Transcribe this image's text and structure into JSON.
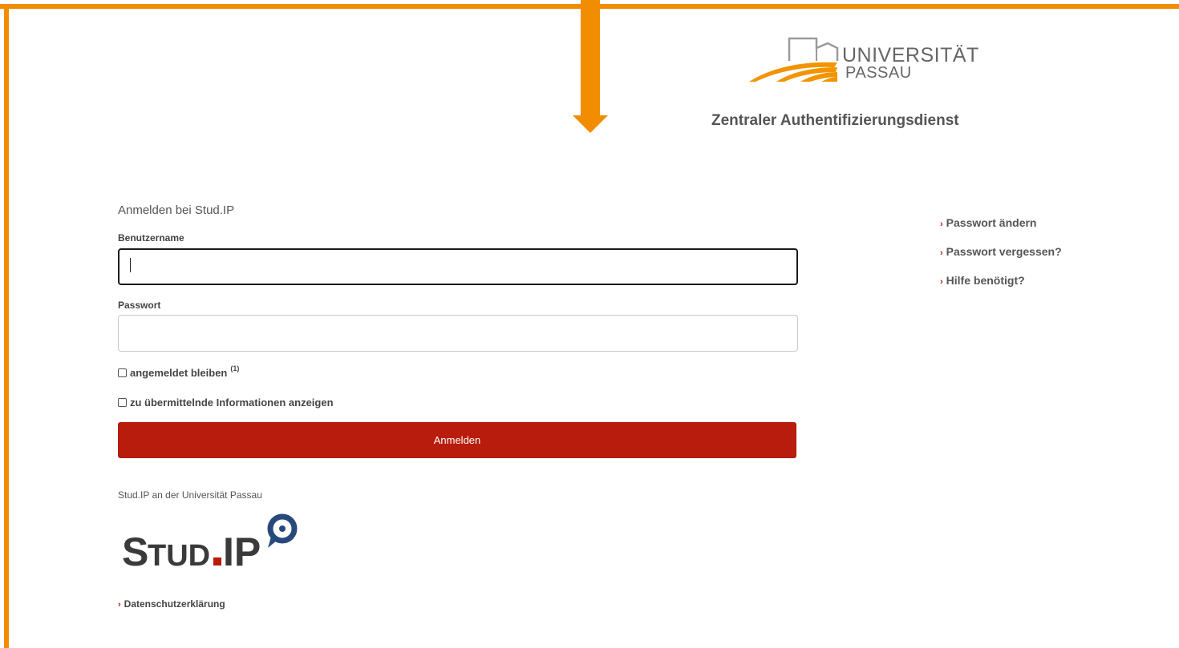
{
  "header": {
    "university_line1": "UNIVERSITÄT",
    "university_line2": "PASSAU",
    "service_title": "Zentraler Authentifizierungsdienst"
  },
  "form": {
    "heading": "Anmelden bei Stud.IP",
    "username_label": "Benutzername",
    "username_value": "",
    "password_label": "Passwort",
    "password_value": "",
    "remember_label": "angemeldet bleiben",
    "remember_sup": "(1)",
    "remember_checked": false,
    "show_info_label": "zu übermittelnde Informationen anzeigen",
    "show_info_checked": false,
    "submit_label": "Anmelden"
  },
  "footer": {
    "service_text": "Stud.IP an der Universität Passau",
    "studip_logo_text": "STUD.IP",
    "privacy_link": "Datenschutzerklärung"
  },
  "sidebar": {
    "links": [
      {
        "label": "Passwort ändern"
      },
      {
        "label": "Passwort vergessen?"
      },
      {
        "label": "Hilfe benötigt?"
      }
    ]
  },
  "colors": {
    "accent_red": "#b71c0c",
    "annotation_orange": "#f28c00",
    "studip_blue": "#28497c"
  },
  "icons": {
    "chevron": "chevron-right-icon",
    "university_logo": "university-passau-logo",
    "studip_logo": "studip-logo"
  }
}
